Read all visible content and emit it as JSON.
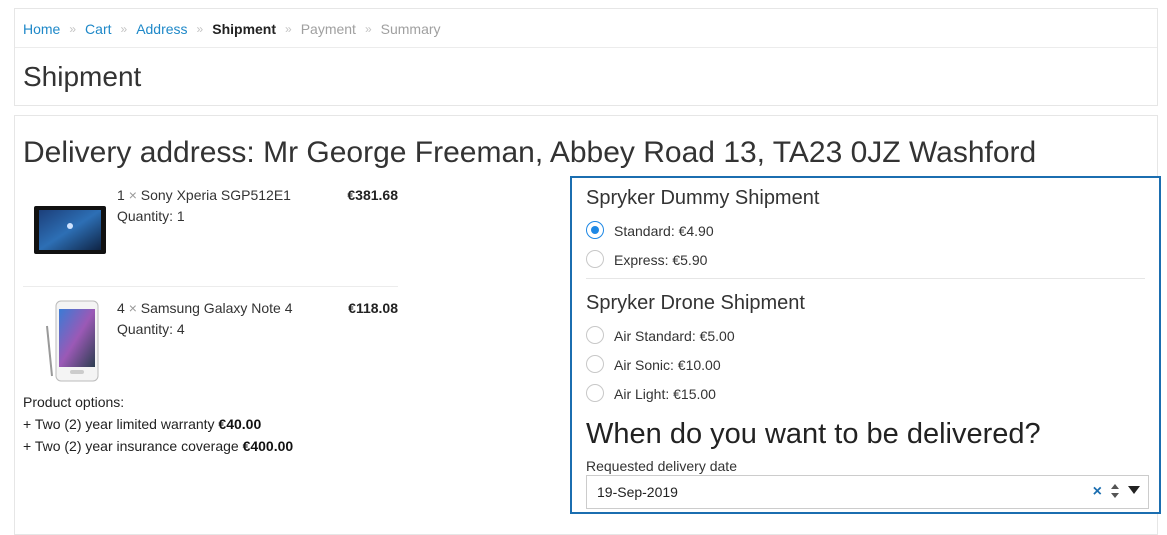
{
  "breadcrumb": {
    "items": [
      {
        "label": "Home",
        "state": "link"
      },
      {
        "label": "Cart",
        "state": "link"
      },
      {
        "label": "Address",
        "state": "link"
      },
      {
        "label": "Shipment",
        "state": "current"
      },
      {
        "label": "Payment",
        "state": "inactive"
      },
      {
        "label": "Summary",
        "state": "inactive"
      }
    ],
    "separator": "»"
  },
  "page_title": "Shipment",
  "delivery_address": "Delivery address: Mr George Freeman, Abbey Road 13, TA23 0JZ Washford",
  "cart": {
    "items": [
      {
        "count": "1",
        "multiplier": "×",
        "name": "Sony Xperia SGP512E1",
        "quantity": "Quantity: 1",
        "price": "€381.68",
        "image_icon": "tablet-product-image"
      },
      {
        "count": "4",
        "multiplier": "×",
        "name": "Samsung Galaxy Note 4",
        "quantity": "Quantity: 4",
        "price": "€118.08",
        "image_icon": "phone-product-image"
      }
    ],
    "options_heading": "Product options:",
    "options": [
      {
        "label": "+ Two (2) year limited warranty",
        "price": "€40.00"
      },
      {
        "label": "+ Two (2) year insurance coverage",
        "price": "€400.00"
      }
    ]
  },
  "shipment": {
    "groups": [
      {
        "title": "Spryker Dummy Shipment",
        "methods": [
          {
            "label": "Standard: €4.90",
            "checked": true
          },
          {
            "label": "Express: €5.90",
            "checked": false
          }
        ]
      },
      {
        "title": "Spryker Drone Shipment",
        "methods": [
          {
            "label": "Air Standard: €5.00",
            "checked": false
          },
          {
            "label": "Air Sonic: €10.00",
            "checked": false
          },
          {
            "label": "Air Light: €15.00",
            "checked": false
          }
        ]
      }
    ],
    "delivery_question": "When do you want to be delivered?",
    "date_label": "Requested delivery date",
    "date_value": "19-Sep-2019",
    "clear_symbol": "×"
  },
  "colors": {
    "accent": "#1b6eb0",
    "link": "#1e88c8",
    "radio_checked": "#1e88e5"
  }
}
